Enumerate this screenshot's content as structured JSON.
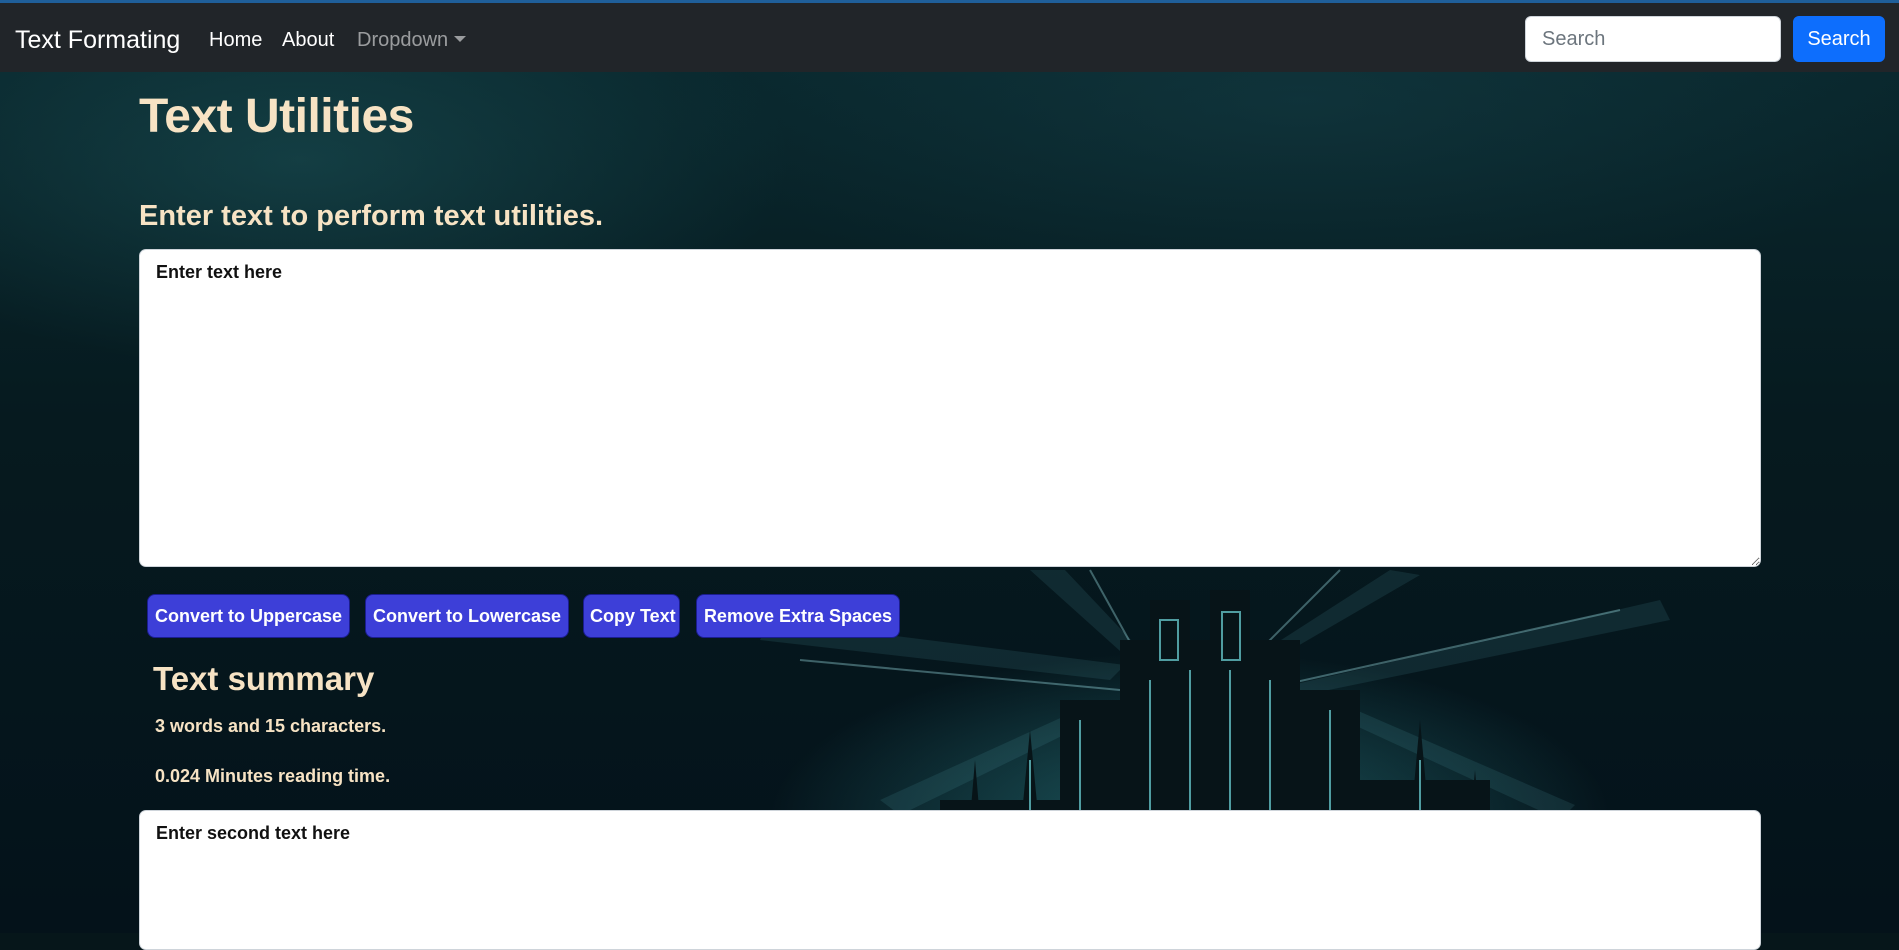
{
  "navbar": {
    "brand": "Text Formating",
    "links": [
      {
        "label": "Home"
      },
      {
        "label": "About"
      },
      {
        "label": "Dropdown"
      }
    ],
    "search": {
      "placeholder": "Search",
      "button_label": "Search"
    }
  },
  "main": {
    "title": "Text Utilities",
    "subtitle": "Enter text to perform text utilities.",
    "textarea_placeholder": "Enter text here",
    "buttons": {
      "uppercase": "Convert to Uppercase",
      "lowercase": "Convert to Lowercase",
      "copy": "Copy Text",
      "remove_spaces": "Remove Extra Spaces"
    },
    "summary": {
      "title": "Text summary",
      "counts": "3 words and 15 characters.",
      "reading_time": "0.024 Minutes reading time."
    },
    "second_textarea_placeholder": "Enter second text here"
  },
  "colors": {
    "navbar_bg": "#212529",
    "primary_button": "#0d6efd",
    "action_button": "#3d3fd8",
    "heading_text": "#f7e3c4"
  }
}
